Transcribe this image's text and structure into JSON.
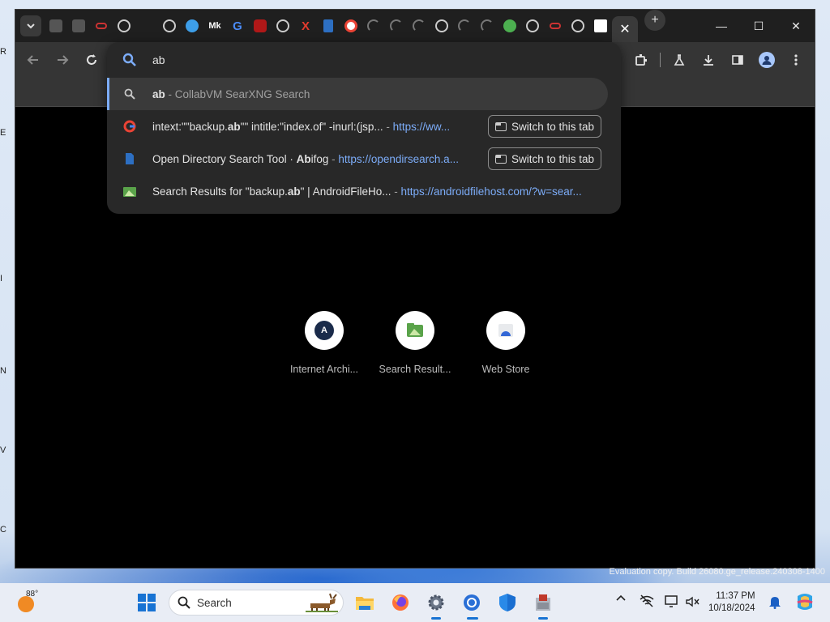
{
  "desktop": {
    "side_letters": [
      "R",
      "E",
      "I",
      "N",
      "V",
      "C"
    ],
    "watermark": "Evaluation copy. Build 26080.ge_release.240308-1400"
  },
  "browser": {
    "tabs": {
      "favicons": [
        "note-icon",
        "note-icon",
        "link-icon",
        "globe-icon",
        "blank-icon",
        "globe-icon",
        "blue-circle-icon",
        "mk-icon",
        "google-g-icon",
        "ublock-icon",
        "globe-icon",
        "x-icon",
        "page-icon",
        "google-icon",
        "loading-icon",
        "loading-icon",
        "loading-icon",
        "globe-icon",
        "loading-icon",
        "loading-icon",
        "green-shield-icon",
        "globe-icon",
        "link-icon",
        "globe-icon",
        "store-icon"
      ],
      "active_close": "✕",
      "new_tab": "+",
      "mk_label": "Mk",
      "g_label": "G",
      "x_label": "X"
    },
    "window_controls": {
      "minimize": "—",
      "maximize": "☐",
      "close": "✕"
    },
    "omnibox": {
      "query": "ab",
      "suggestions": [
        {
          "icon": "search-icon",
          "bold": "ab",
          "rest": "",
          "sep": " - ",
          "url": "CollabVM SearXNG Search",
          "url_style": "dim",
          "selected": true
        },
        {
          "icon": "google-icon",
          "pre": "intext:\"\"backup.",
          "bold": "ab",
          "rest": "\"\" intitle:\"index.of\" -inurl:(jsp...",
          "sep": " - ",
          "url": "https://ww...",
          "switch": "Switch to this tab"
        },
        {
          "icon": "page-icon",
          "pre": "Open Directory Search Tool · ",
          "bold": "Ab",
          "rest": "ifog",
          "sep": " - ",
          "url": "https://opendirsearch.a...",
          "switch": "Switch to this tab"
        },
        {
          "icon": "androidfilehost-icon",
          "pre": "Search Results for \"backup.",
          "bold": "ab",
          "rest": "\" | AndroidFileHo...",
          "sep": " - ",
          "url": "https://androidfilehost.com/?w=sear..."
        }
      ]
    },
    "shortcuts": [
      {
        "label": "Internet Archi...",
        "glyph": "A"
      },
      {
        "label": "Search Result...",
        "glyph": ""
      },
      {
        "label": "Web Store",
        "glyph": ""
      }
    ]
  },
  "taskbar": {
    "weather_temp": "88°",
    "search_placeholder": "Search",
    "clock_time": "11:37 PM",
    "clock_date": "10/18/2024",
    "tray_chevron": "^"
  }
}
